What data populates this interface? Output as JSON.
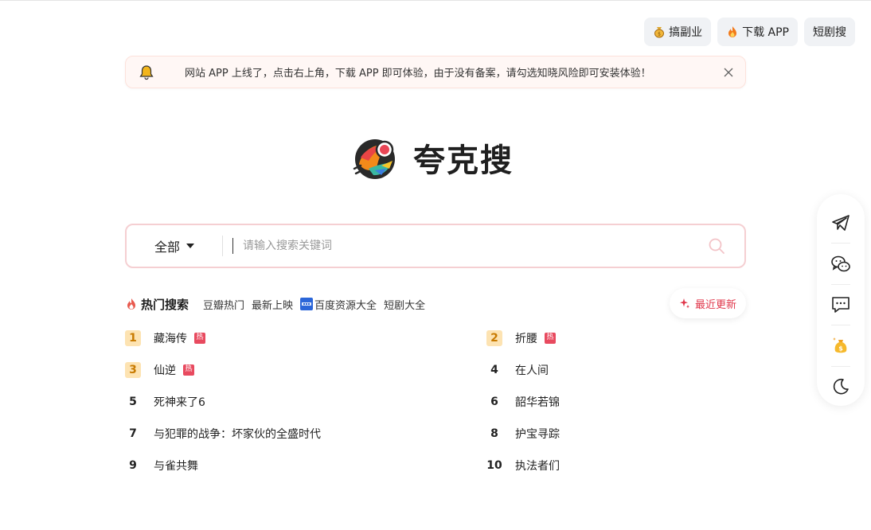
{
  "top_actions": {
    "side_hustle": "搞副业",
    "download_app": "下载 APP",
    "short_drama": "短剧搜"
  },
  "notice": {
    "message": "网站 APP 上线了，点击右上角，下载 APP 即可体验，由于没有备案，请勾选知晓风险即可安装体验！"
  },
  "brand": {
    "name": "夸克搜"
  },
  "search": {
    "scope": "全部",
    "placeholder": "请输入搜索关键词",
    "value": ""
  },
  "hot": {
    "title": "热门搜索",
    "links": [
      "豆瓣热门",
      "最新上映",
      "百度资源大全",
      "短剧大全"
    ],
    "recent": "最近更新",
    "hot_badge": "热",
    "items": [
      {
        "rank": "1",
        "title": "藏海传",
        "hot": true
      },
      {
        "rank": "2",
        "title": "折腰",
        "hot": true
      },
      {
        "rank": "3",
        "title": "仙逆",
        "hot": true
      },
      {
        "rank": "4",
        "title": "在人间",
        "hot": false
      },
      {
        "rank": "5",
        "title": "死神来了6",
        "hot": false
      },
      {
        "rank": "6",
        "title": "韶华若锦",
        "hot": false
      },
      {
        "rank": "7",
        "title": "与犯罪的战争：坏家伙的全盛时代",
        "hot": false
      },
      {
        "rank": "8",
        "title": "护宝寻踪",
        "hot": false
      },
      {
        "rank": "9",
        "title": "与雀共舞",
        "hot": false
      },
      {
        "rank": "10",
        "title": "执法者们",
        "hot": false
      }
    ]
  },
  "sidebar": {
    "icons": [
      "telegram-icon",
      "wechat-icon",
      "comment-icon",
      "money-bag-icon",
      "moon-icon"
    ]
  },
  "colors": {
    "accent": "#e0364a",
    "rank_top_bg": "#fde3b2",
    "rank_top_fg": "#c87a00",
    "search_border": "#f5cfd2",
    "notice_bg": "#fff7f5"
  }
}
